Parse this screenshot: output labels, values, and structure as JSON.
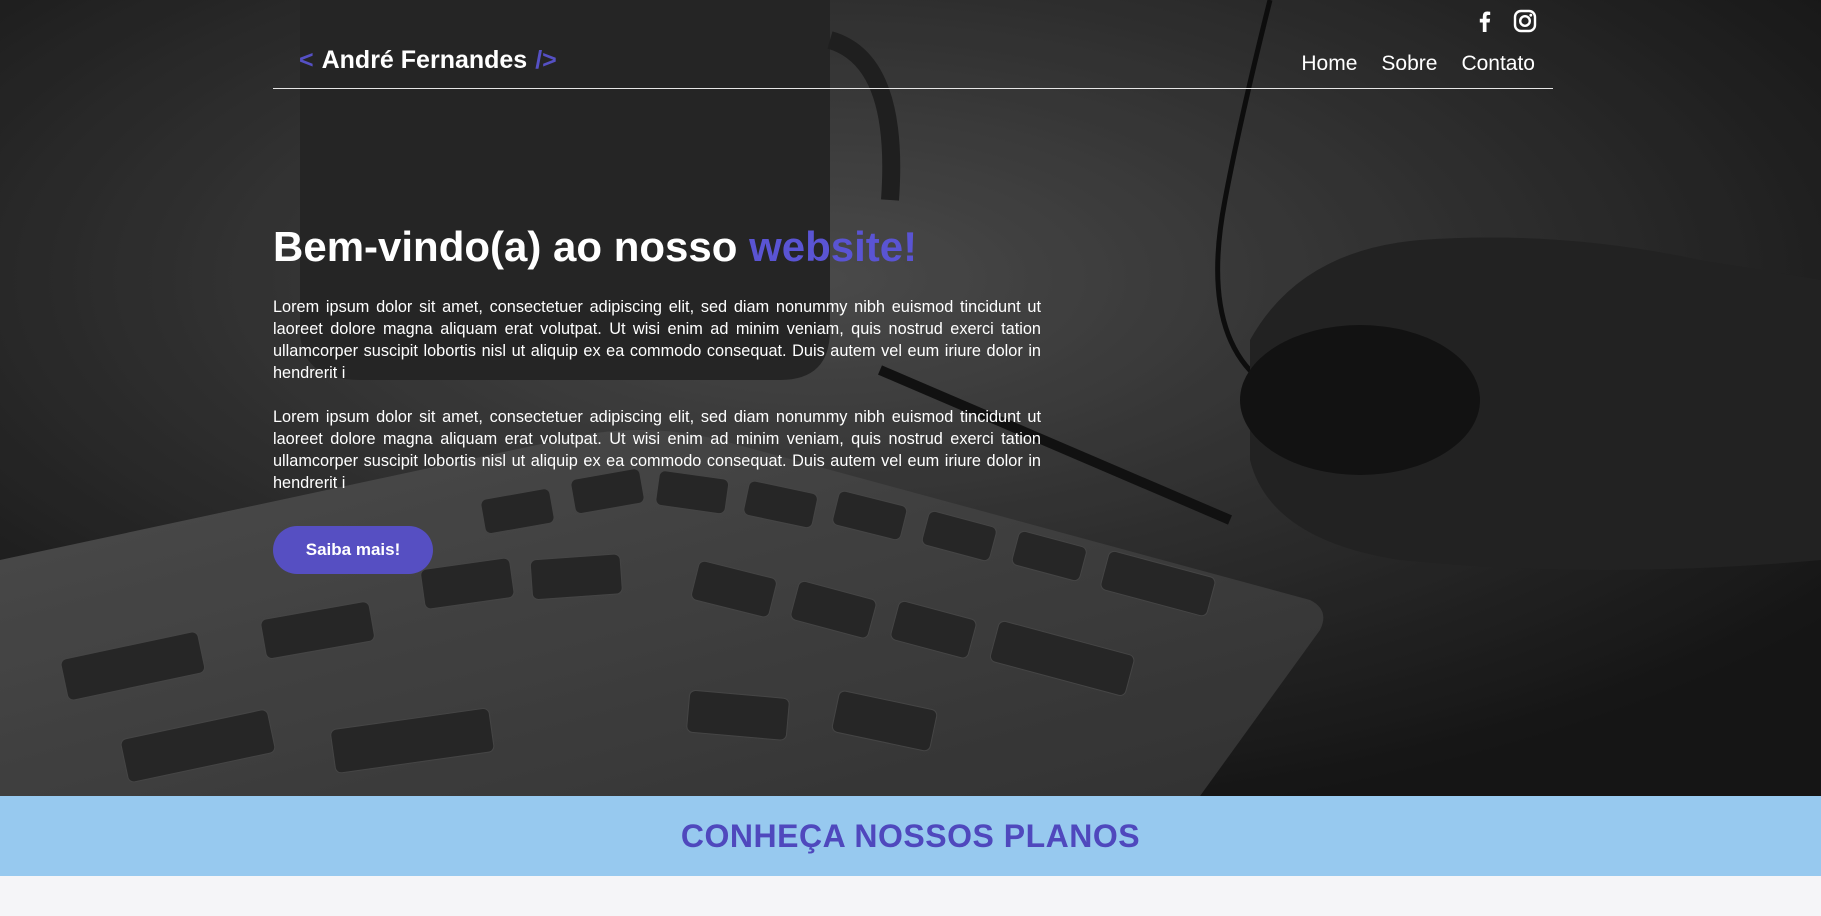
{
  "header": {
    "logo_open": "<",
    "logo_name": "André Fernandes",
    "logo_close": "/>",
    "nav": [
      "Home",
      "Sobre",
      "Contato"
    ],
    "social_icons": [
      "facebook-icon",
      "instagram-icon"
    ]
  },
  "hero": {
    "title_main": "Bem-vindo(a) ao nosso",
    "title_accent": "website!",
    "paragraphs": [
      "Lorem ipsum dolor sit amet, consectetuer adipiscing elit, sed diam nonummy nibh euismod tincidunt ut laoreet dolore magna aliquam erat volutpat. Ut wisi enim ad minim veniam, quis nostrud exerci tation ullamcorper suscipit lobortis nisl ut aliquip ex ea commodo consequat. Duis autem vel eum iriure dolor in hendrerit i",
      "Lorem ipsum dolor sit amet, consectetuer adipiscing elit, sed diam nonummy nibh euismod tincidunt ut laoreet dolore magna aliquam erat volutpat. Ut wisi enim ad minim veniam, quis nostrud exerci tation ullamcorper suscipit lobortis nisl ut aliquip ex ea commodo consequat. Duis autem vel eum iriure dolor in hendrerit i"
    ],
    "cta_label": "Saiba mais!"
  },
  "plans": {
    "title": "CONHEÇA NOSSOS PLANOS"
  },
  "colors": {
    "accent": "#5a54d3",
    "button": "#564fc2",
    "plans_band": "#97c9ef",
    "plans_text": "#4f48bd"
  }
}
